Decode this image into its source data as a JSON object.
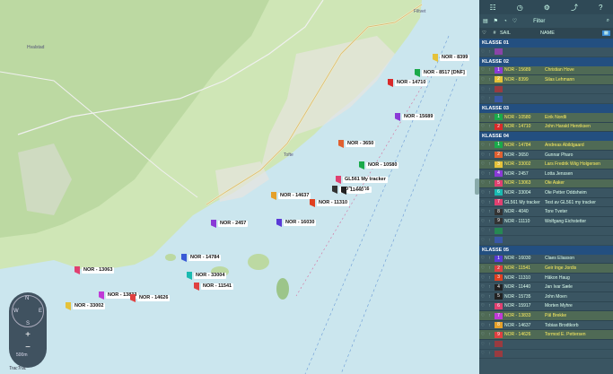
{
  "map": {
    "towns": [
      "Hvalstad",
      "Filtvet",
      "Tofte"
    ],
    "boats": [
      {
        "label": "NOR - 8399",
        "num": "2",
        "color": "#e5c23a"
      },
      {
        "label": "NOR - 8517 [DNF]",
        "num": "",
        "color": "#1aaa4a"
      },
      {
        "label": "NOR - 14710",
        "num": "",
        "color": "#d92a2a"
      },
      {
        "label": "NOR - 15689",
        "num": "",
        "color": "#8a3ad6"
      },
      {
        "label": "NOR - 3650",
        "num": "",
        "color": "#e06030"
      },
      {
        "label": "NOR - 10580",
        "num": "",
        "color": "#1aaa4a"
      },
      {
        "label": "GL561 My tracker",
        "num": "",
        "color": "#e04070"
      },
      {
        "label": "NOR - 11116",
        "num": "",
        "color": "#333333"
      },
      {
        "label": "NOR - 14637",
        "num": "",
        "color": "#e5a02a"
      },
      {
        "label": "NOR - 11310",
        "num": "",
        "color": "#e04020"
      },
      {
        "label": "11440",
        "num": "",
        "color": "#222222"
      },
      {
        "label": "NOR - 2457",
        "num": "",
        "color": "#8a3ad6"
      },
      {
        "label": "NOR - 16030",
        "num": "",
        "color": "#5a3ad6"
      },
      {
        "label": "NOR - 14784",
        "num": "",
        "color": "#3a5ad6"
      },
      {
        "label": "NOR - 13063",
        "num": "",
        "color": "#e04070"
      },
      {
        "label": "NOR - 33004",
        "num": "",
        "color": "#1abab0"
      },
      {
        "label": "NOR - 11541",
        "num": "",
        "color": "#e04040"
      },
      {
        "label": "NOR - 13833",
        "num": "",
        "color": "#c03ad6"
      },
      {
        "label": "NOR - 14626",
        "num": "",
        "color": "#e04040"
      },
      {
        "label": "NOR - 33002",
        "num": "",
        "color": "#e5c23a"
      }
    ],
    "compass": {
      "n": "N",
      "e": "E",
      "w": "W",
      "s": "S"
    },
    "zoom_in": "+",
    "zoom_out": "−",
    "scale": "500m",
    "brand": "TracTrac"
  },
  "sidebar": {
    "filter_label": "Filter",
    "columns": {
      "num": "#",
      "sail": "SAIL",
      "name": "NAME"
    },
    "classes": [
      {
        "title": "KLASSE 01",
        "rows": [
          {
            "num": "",
            "sail": "",
            "name": "",
            "color": "#c03ad6",
            "empty": true
          }
        ]
      },
      {
        "title": "KLASSE 02",
        "rows": [
          {
            "num": "1",
            "sail": "NOR - 15689",
            "name": "Christian Hove",
            "color": "#8a3ad6",
            "hl": true
          },
          {
            "num": "2",
            "sail": "NOR - 8399",
            "name": "Silas Lehmann",
            "color": "#e5c23a",
            "hl": true
          },
          {
            "num": "",
            "sail": "",
            "name": "",
            "color": "#d92a2a",
            "empty": true
          },
          {
            "num": "",
            "sail": "",
            "name": "",
            "color": "#3a5ad6",
            "empty": true
          }
        ]
      },
      {
        "title": "KLASSE 03",
        "rows": [
          {
            "num": "1",
            "sail": "NOR - 10580",
            "name": "Eirik Nordli",
            "color": "#1aaa4a",
            "hl": true
          },
          {
            "num": "2",
            "sail": "NOR - 14710",
            "name": "John Harald Henriksen",
            "color": "#d92a2a",
            "hl": true
          }
        ]
      },
      {
        "title": "KLASSE 04",
        "rows": [
          {
            "num": "1",
            "sail": "NOR - 14784",
            "name": "Andreas Abildgaard",
            "color": "#1aaa4a",
            "hl": true
          },
          {
            "num": "2",
            "sail": "NOR - 3650",
            "name": "Gunnar Pharo",
            "color": "#e06030"
          },
          {
            "num": "3",
            "sail": "NOR - 33002",
            "name": "Lars Fredrik Wiig Holgersen",
            "color": "#e5c23a",
            "hl": true
          },
          {
            "num": "4",
            "sail": "NOR - 2457",
            "name": "Lotta Jenssen",
            "color": "#8a3ad6"
          },
          {
            "num": "5",
            "sail": "NOR - 13063",
            "name": "Ole Aaker",
            "color": "#e04070",
            "hl": true
          },
          {
            "num": "6",
            "sail": "NOR - 33004",
            "name": "Ole Petter Oddsheim",
            "color": "#1abab0"
          },
          {
            "num": "7",
            "sail": "GL561 My tracker",
            "name": "Test av GL561 my tracker",
            "color": "#e04070"
          },
          {
            "num": "8",
            "sail": "NOR - 4040",
            "name": "Tore Tveter",
            "color": "#333333"
          },
          {
            "num": "9",
            "sail": "NOR - 11110",
            "name": "Wolfgang Eichstetter",
            "color": "#333333"
          },
          {
            "num": "",
            "sail": "",
            "name": "",
            "color": "#1aaa4a",
            "empty": true
          },
          {
            "num": "",
            "sail": "",
            "name": "",
            "color": "#3a5ad6",
            "empty": true
          }
        ]
      },
      {
        "title": "KLASSE 05",
        "rows": [
          {
            "num": "1",
            "sail": "NOR - 16030",
            "name": "Claes Eliasson",
            "color": "#5a3ad6"
          },
          {
            "num": "2",
            "sail": "NOR - 11541",
            "name": "Geir Inge Jordis",
            "color": "#e04040",
            "hl": true
          },
          {
            "num": "3",
            "sail": "NOR - 11310",
            "name": "Håkon Haug",
            "color": "#e04020"
          },
          {
            "num": "4",
            "sail": "NOR - 11440",
            "name": "Jan Ivar Sæle",
            "color": "#222222"
          },
          {
            "num": "5",
            "sail": "NOR - 15735",
            "name": "John Moen",
            "color": "#222222"
          },
          {
            "num": "6",
            "sail": "NOR - 15917",
            "name": "Morten Myhre",
            "color": "#e04070"
          },
          {
            "num": "7",
            "sail": "NOR - 13833",
            "name": "Pål Brekke",
            "color": "#c03ad6",
            "hl": true
          },
          {
            "num": "8",
            "sail": "NOR - 14637",
            "name": "Tobias Brodtkorb",
            "color": "#e5a02a"
          },
          {
            "num": "9",
            "sail": "NOR - 14626",
            "name": "Tormod E. Pettersen",
            "color": "#e04040",
            "hl": true
          },
          {
            "num": "",
            "sail": "",
            "name": "",
            "color": "#d92a2a",
            "empty": true
          },
          {
            "num": "",
            "sail": "",
            "name": "",
            "color": "#d92a2a",
            "empty": true
          }
        ]
      }
    ]
  }
}
